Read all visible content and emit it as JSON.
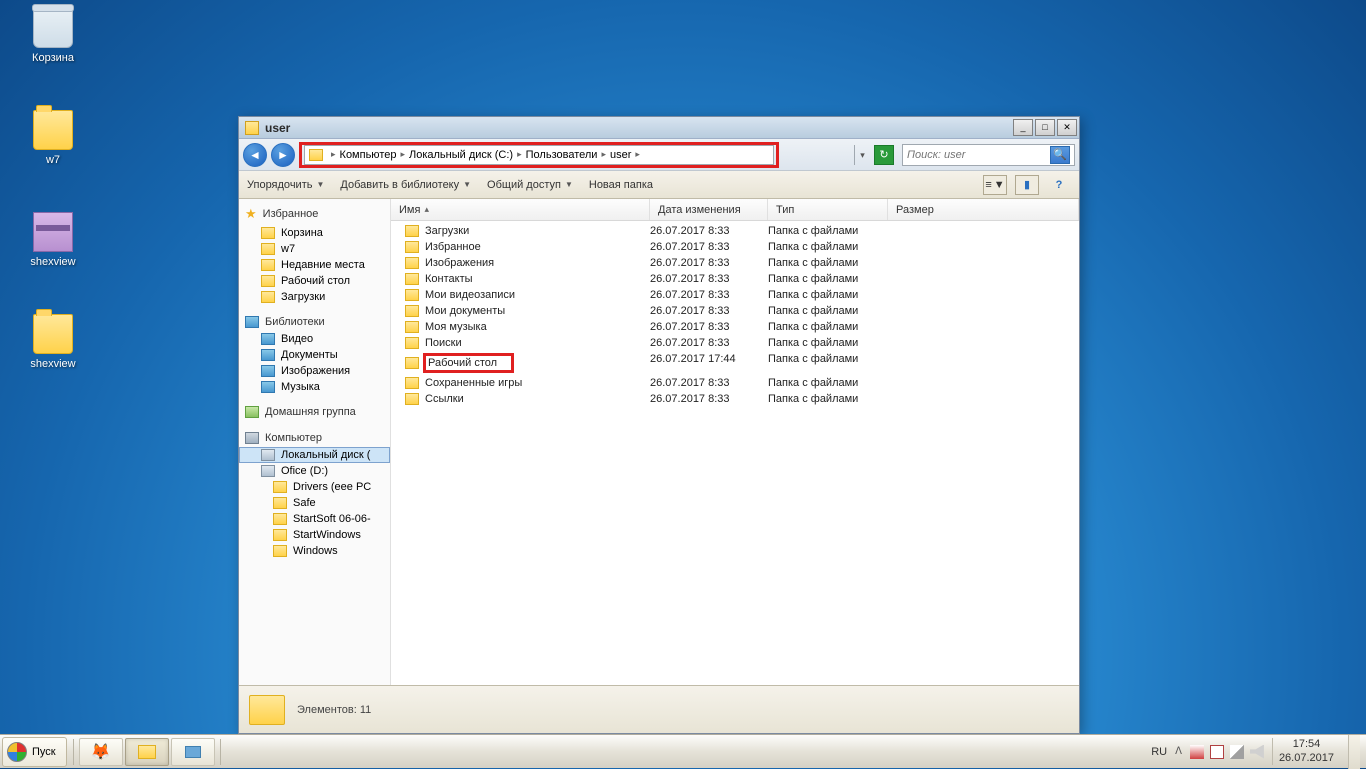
{
  "desktop": {
    "icons": [
      {
        "label": "Корзина",
        "icon": "bin"
      },
      {
        "label": "w7",
        "icon": "folder"
      },
      {
        "label": "shexview",
        "icon": "rar"
      },
      {
        "label": "shexview",
        "icon": "folder"
      }
    ]
  },
  "window": {
    "title": "user",
    "breadcrumbs": [
      "Компьютер",
      "Локальный диск (C:)",
      "Пользователи",
      "user"
    ],
    "search_placeholder": "Поиск: user",
    "toolbar": {
      "organize": "Упорядочить",
      "add_library": "Добавить в библиотеку",
      "share": "Общий доступ",
      "new_folder": "Новая папка"
    },
    "columns": {
      "name": "Имя",
      "date": "Дата изменения",
      "type": "Тип",
      "size": "Размер"
    },
    "sidebar": {
      "favorites": {
        "label": "Избранное",
        "items": [
          "Корзина",
          "w7",
          "Недавние места",
          "Рабочий стол",
          "Загрузки"
        ]
      },
      "libraries": {
        "label": "Библиотеки",
        "items": [
          "Видео",
          "Документы",
          "Изображения",
          "Музыка"
        ]
      },
      "homegroup": {
        "label": "Домашняя группа"
      },
      "computer": {
        "label": "Компьютер",
        "items": [
          "Локальный диск (",
          "Ofice (D:)"
        ],
        "subitems": [
          "Drivers (eee PC",
          "Safe",
          "StartSoft 06-06-",
          "StartWindows",
          "Windows"
        ]
      }
    },
    "files": [
      {
        "name": "Загрузки",
        "date": "26.07.2017 8:33",
        "type": "Папка с файлами"
      },
      {
        "name": "Избранное",
        "date": "26.07.2017 8:33",
        "type": "Папка с файлами"
      },
      {
        "name": "Изображения",
        "date": "26.07.2017 8:33",
        "type": "Папка с файлами"
      },
      {
        "name": "Контакты",
        "date": "26.07.2017 8:33",
        "type": "Папка с файлами"
      },
      {
        "name": "Мои видеозаписи",
        "date": "26.07.2017 8:33",
        "type": "Папка с файлами"
      },
      {
        "name": "Мои документы",
        "date": "26.07.2017 8:33",
        "type": "Папка с файлами"
      },
      {
        "name": "Моя музыка",
        "date": "26.07.2017 8:33",
        "type": "Папка с файлами"
      },
      {
        "name": "Поиски",
        "date": "26.07.2017 8:33",
        "type": "Папка с файлами"
      },
      {
        "name": "Рабочий стол",
        "date": "26.07.2017 17:44",
        "type": "Папка с файлами",
        "highlight": true
      },
      {
        "name": "Сохраненные игры",
        "date": "26.07.2017 8:33",
        "type": "Папка с файлами"
      },
      {
        "name": "Ссылки",
        "date": "26.07.2017 8:33",
        "type": "Папка с файлами"
      }
    ],
    "status": "Элементов: 11"
  },
  "taskbar": {
    "start": "Пуск",
    "lang": "RU",
    "time": "17:54",
    "date": "26.07.2017"
  }
}
